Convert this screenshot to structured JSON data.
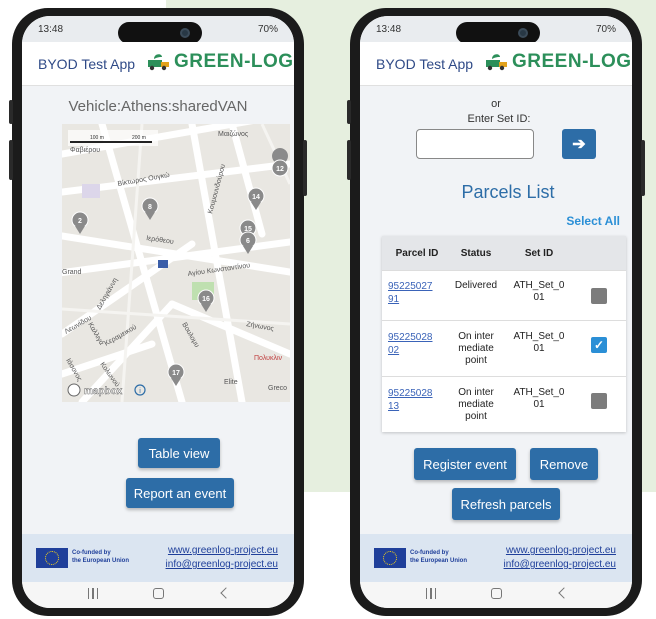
{
  "status": {
    "time": "13:48",
    "battery": "70%"
  },
  "app": {
    "title": "BYOD Test App",
    "logo_text": "GREEN-LOG"
  },
  "phone1": {
    "vehicle": "Vehicle:Athens:sharedVAN",
    "map": {
      "scale": "100 m",
      "scale2": "200 m",
      "attribution": "mapbox",
      "streets": [
        "Φαβιέρου",
        "Βίκτωρος Ουγκώ",
        "Ιερόθεου",
        "Αγίου Κωνσταντίνου",
        "Δεληγιάννη",
        "Καλλιγά",
        "Λεωνίδου",
        "Κεραμεικού",
        "Ιάσονος",
        "Κολωνού",
        "Βουλομυ",
        "Ζήνωνος",
        "Μαιζώνος",
        "Κουμουνδούρου",
        "Πολυκλιν",
        "Elite",
        "Greco",
        "Grand"
      ],
      "markers": [
        "12",
        "8",
        "14",
        "15",
        "2",
        "6",
        "16",
        "17"
      ]
    },
    "buttons": {
      "table_view": "Table view",
      "report_event": "Report an event"
    }
  },
  "phone2": {
    "or": "or",
    "enter_set_id": "Enter Set ID:",
    "set_id_value": "",
    "parcels_title": "Parcels List",
    "select_all": "Select All",
    "columns": [
      "Parcel ID",
      "Status",
      "Set ID"
    ],
    "rows": [
      {
        "id_line1": "95225027",
        "id_line2": "91",
        "status": [
          "Delivered"
        ],
        "set": [
          "ATH_Set_0",
          "01"
        ],
        "checked": false
      },
      {
        "id_line1": "95225028",
        "id_line2": "02",
        "status": [
          "On inter",
          "mediate",
          "point"
        ],
        "set": [
          "ATH_Set_0",
          "01"
        ],
        "checked": true
      },
      {
        "id_line1": "95225028",
        "id_line2": "13",
        "status": [
          "On inter",
          "mediate",
          "point"
        ],
        "set": [
          "ATH_Set_0",
          "01"
        ],
        "checked": false
      }
    ],
    "buttons": {
      "register_event": "Register event",
      "remove": "Remove",
      "refresh": "Refresh parcels"
    }
  },
  "footer": {
    "eu_line1": "Co-funded by",
    "eu_line2": "the European Union",
    "website": "www.greenlog-project.eu",
    "email": "info@greenlog-project.eu"
  },
  "colors": {
    "primary_button": "#2d6da7",
    "brand_green": "#2c8f5a",
    "app_title": "#2f4a87",
    "select_all": "#2b8fd6"
  }
}
